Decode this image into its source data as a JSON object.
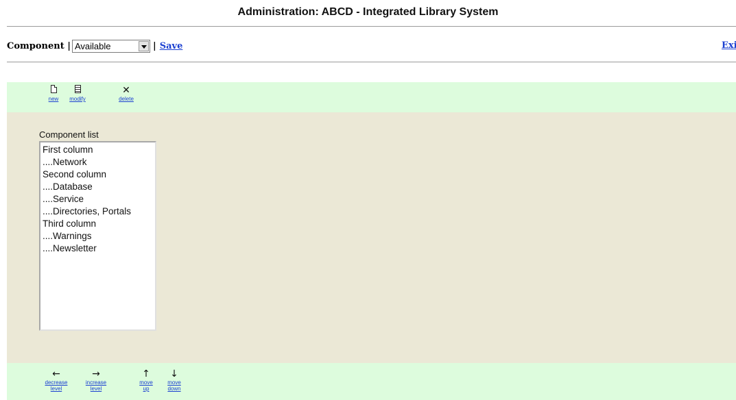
{
  "header": {
    "title": "Administration: ABCD - Integrated Library System"
  },
  "toolbar": {
    "component_label": "Component |",
    "component_select_value": "Available",
    "separator": "|",
    "save_label": "Save",
    "exit_label": "Exi"
  },
  "top_tools": {
    "new": {
      "label": "new",
      "icon": "new-document-icon"
    },
    "modify": {
      "label": "modify",
      "icon": "edit-document-icon"
    },
    "delete": {
      "label": "delete",
      "icon": "close-icon",
      "glyph": "✕"
    }
  },
  "component_list": {
    "label": "Component list",
    "items": [
      "First column",
      "....Network",
      "Second column",
      "....Database",
      "....Service",
      "....Directories, Portals",
      "Third column",
      "....Warnings",
      "....Newsletter"
    ]
  },
  "bottom_tools": {
    "decrease_level": {
      "label1": "decrease",
      "label2": "level",
      "glyph": "←",
      "icon": "arrow-left-icon"
    },
    "increase_level": {
      "label1": "increase",
      "label2": "level",
      "glyph": "→",
      "icon": "arrow-right-icon"
    },
    "move_up": {
      "label1": "move",
      "label2": "up",
      "glyph": "↑",
      "icon": "arrow-up-icon"
    },
    "move_down": {
      "label1": "move",
      "label2": "down",
      "glyph": "↓",
      "icon": "arrow-down-icon"
    }
  },
  "colors": {
    "band_green": "#ddfcdd",
    "panel_beige": "#ebe8d6",
    "link_blue": "#1a3fd1"
  }
}
